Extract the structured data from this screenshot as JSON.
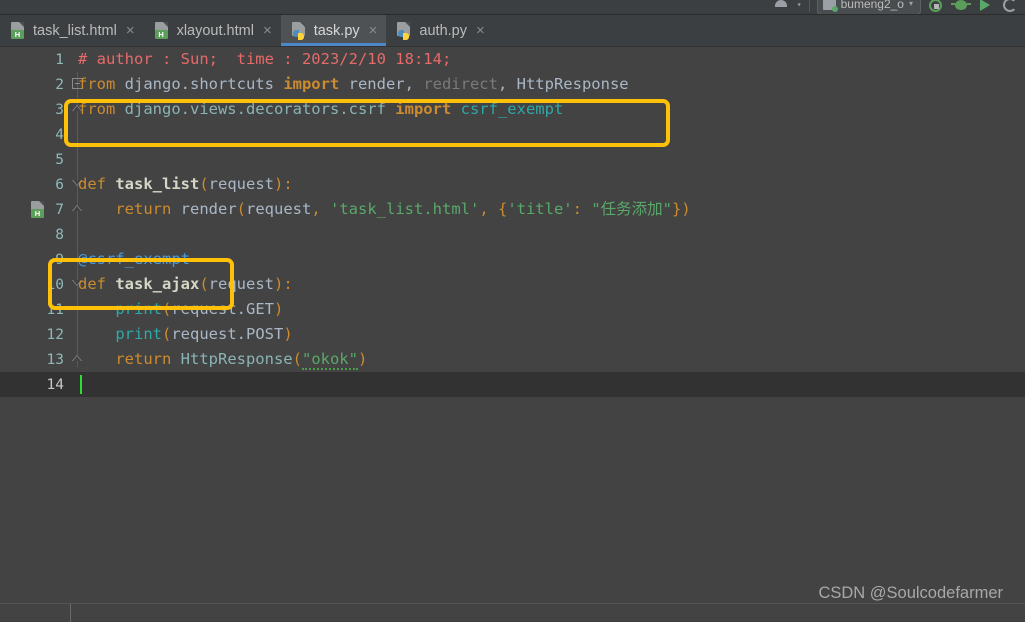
{
  "app": {
    "watermark": "CSDN @Soulcodefarmer"
  },
  "toolbar": {
    "run_config": "bumeng2_o",
    "config_caret": "▾",
    "avatar_caret": "▾",
    "icons": [
      {
        "name": "avatar-icon",
        "label": "avatar"
      },
      {
        "name": "stop-icon",
        "label": "stop"
      },
      {
        "name": "debug-icon",
        "label": "debug"
      },
      {
        "name": "run-icon",
        "label": "run"
      },
      {
        "name": "coverage-icon",
        "label": "run-with-coverage"
      }
    ]
  },
  "tabs": [
    {
      "label": "task_list.html",
      "icon": "html-file-icon",
      "badge": "H",
      "type": "html",
      "active": false,
      "close": "×"
    },
    {
      "label": "xlayout.html",
      "icon": "html-file-icon",
      "badge": "H",
      "type": "html",
      "active": false,
      "close": "×"
    },
    {
      "label": "task.py",
      "icon": "python-file-icon",
      "badge": "",
      "type": "py",
      "active": true,
      "close": "×"
    },
    {
      "label": "auth.py",
      "icon": "python-file-icon",
      "badge": "",
      "type": "py",
      "active": false,
      "close": "×"
    }
  ],
  "editor": {
    "current_line": 14,
    "line_numbers": [
      "1",
      "2",
      "3",
      "4",
      "5",
      "6",
      "7",
      "8",
      "9",
      "10",
      "11",
      "12",
      "13",
      "14"
    ],
    "gutter_icons": [
      {
        "line": 7,
        "name": "html-file-gutter-icon",
        "badge": "H"
      }
    ],
    "lines": [
      {
        "n": 1,
        "text": "# author : Sun;  time : 2023/2/10 18:14;"
      },
      {
        "n": 2,
        "text": "from django.shortcuts import render, redirect, HttpResponse"
      },
      {
        "n": 3,
        "text": "from django.views.decorators.csrf import csrf_exempt"
      },
      {
        "n": 4,
        "text": ""
      },
      {
        "n": 5,
        "text": ""
      },
      {
        "n": 6,
        "text": "def task_list(request):"
      },
      {
        "n": 7,
        "text": "    return render(request, 'task_list.html', {'title': \"任务添加\"})"
      },
      {
        "n": 8,
        "text": ""
      },
      {
        "n": 9,
        "text": "@csrf_exempt"
      },
      {
        "n": 10,
        "text": "def task_ajax(request):"
      },
      {
        "n": 11,
        "text": "    print(request.GET)"
      },
      {
        "n": 12,
        "text": "    print(request.POST)"
      },
      {
        "n": 13,
        "text": "    return HttpResponse(\"okok\")"
      },
      {
        "n": 14,
        "text": ""
      }
    ]
  },
  "annotations": [
    {
      "name": "highlight-import-csrf",
      "target_line": 3,
      "color": "#ffc107"
    },
    {
      "name": "highlight-csrf-exempt-decorator",
      "target_line": 9,
      "color": "#ffc107"
    }
  ],
  "colors": {
    "editor_bg": "#434343",
    "gutter_fg": "#8fb9b9",
    "current_line_bg": "#323232",
    "accent_tab": "#4a88c7",
    "annotation": "#ffc107",
    "comment": "#e76a6a",
    "keyword": "#cc8b2e",
    "string": "#59a869",
    "caret": "#2ee02e"
  }
}
